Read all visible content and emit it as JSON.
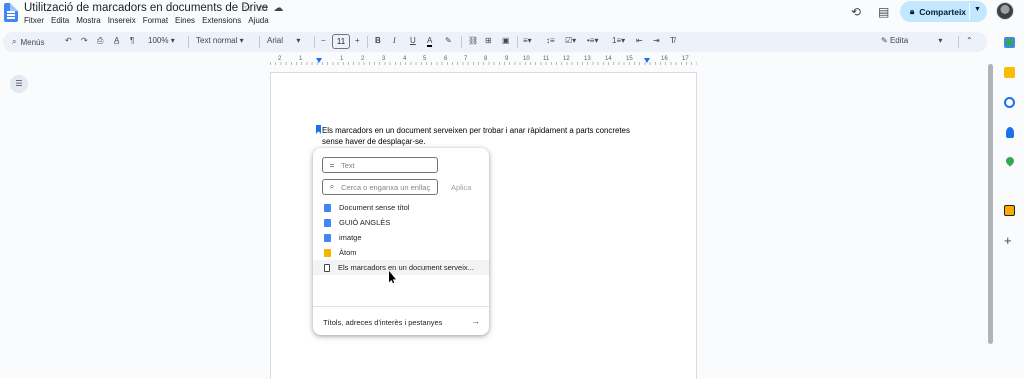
{
  "header": {
    "title": "Utilització de marcadors en documents de Drive",
    "title_icons": [
      "star-icon",
      "folder-move-icon",
      "cloud-status-icon"
    ],
    "menu": [
      "Fitxer",
      "Edita",
      "Mostra",
      "Insereix",
      "Format",
      "Eines",
      "Extensions",
      "Ajuda"
    ],
    "share_label": "Comparteix"
  },
  "toolbar": {
    "menus_label": "Menús",
    "zoom": "100%",
    "style": "Text normal",
    "font": "Arial",
    "font_size": "11",
    "bold": "B",
    "italic": "I",
    "underline": "U",
    "text_color": "A",
    "mode_label": "Edita"
  },
  "ruler": {
    "numbers": [
      "2",
      "1",
      "1",
      "2",
      "3",
      "4",
      "5",
      "6",
      "7",
      "8",
      "9",
      "10",
      "11",
      "12",
      "13",
      "14",
      "15",
      "16",
      "17",
      "18"
    ]
  },
  "document": {
    "paragraph": "Els marcadors en un document serveixen per trobar i anar ràpidament a parts concretes sense haver de desplaçar-se."
  },
  "link_popup": {
    "text_placeholder": "Text",
    "search_placeholder": "Cerca o enganxa un enllaç",
    "apply_label": "Aplica",
    "items": [
      {
        "label": "Document sense títol",
        "icon": "doc-icon"
      },
      {
        "label": "GUIÓ ANGLÈS",
        "icon": "doc-icon"
      },
      {
        "label": "imatge",
        "icon": "doc-icon"
      },
      {
        "label": "Àtom",
        "icon": "slides-icon"
      },
      {
        "label": "Els marcadors en un document serveix...",
        "icon": "bookmark-icon"
      }
    ],
    "footer": "Títols, adreces d'interès i pestanyes"
  },
  "colors": {
    "accent": "#1a73e8",
    "share_bg": "#c2e7ff",
    "toolbar_bg": "#edf2fa",
    "page_bg": "#f9fbfd"
  }
}
